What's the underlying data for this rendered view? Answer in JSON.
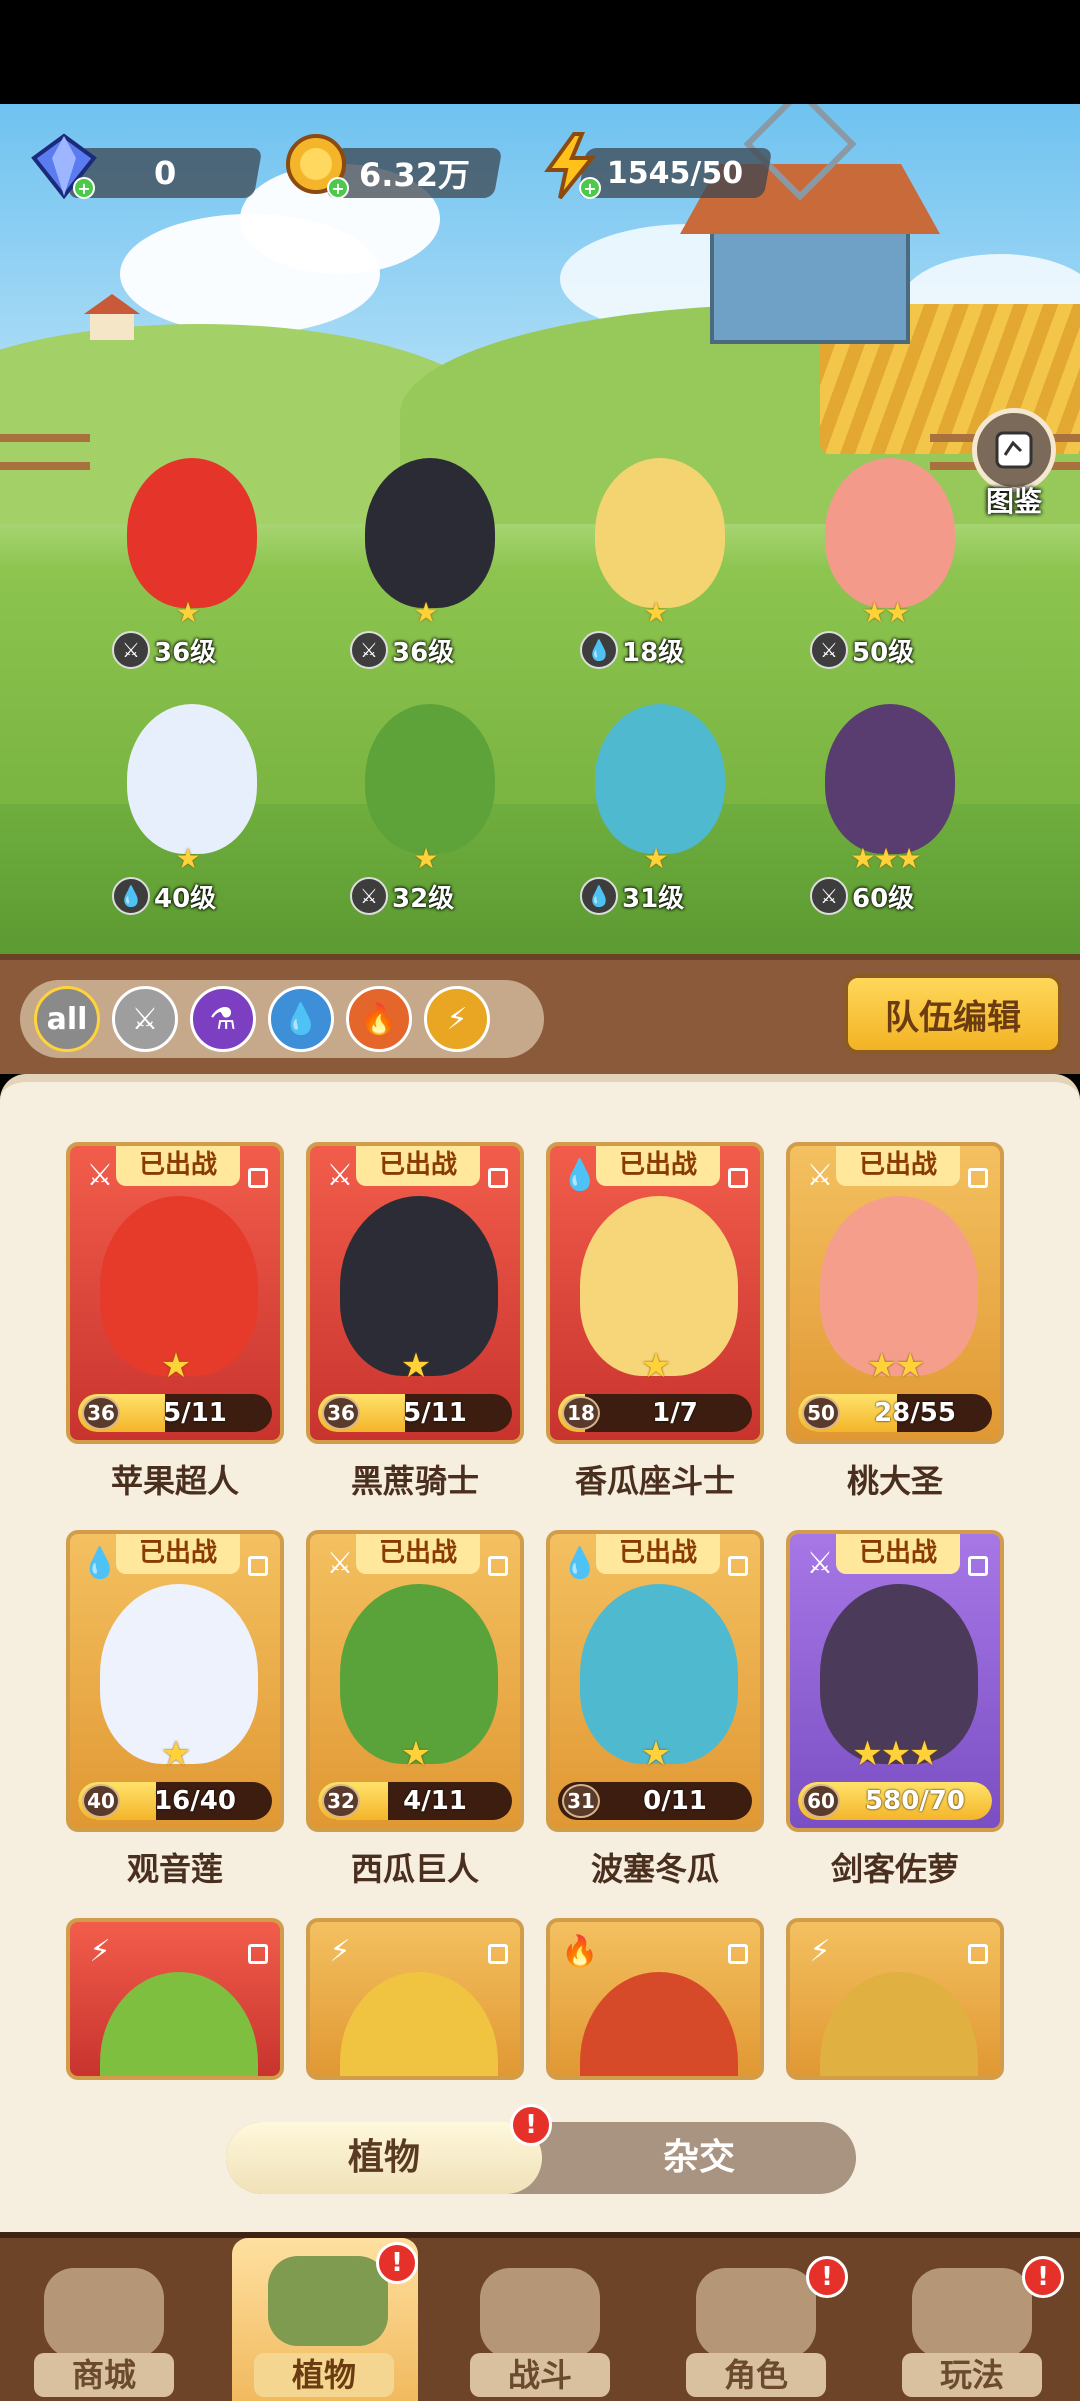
{
  "currencies": {
    "diamonds": "0",
    "coins": "6.32万",
    "energy": "1545/50"
  },
  "codex": {
    "label": "图鉴"
  },
  "field_units": [
    {
      "level": "36级",
      "element": "sword",
      "stars": "★",
      "color": "#e5352a"
    },
    {
      "level": "36级",
      "element": "sword",
      "stars": "★",
      "color": "#2b2b35"
    },
    {
      "level": "18级",
      "element": "water",
      "stars": "★",
      "color": "#f4d470"
    },
    {
      "level": "50级",
      "element": "sword",
      "stars": "★★",
      "color": "#f39a8a"
    },
    {
      "level": "40级",
      "element": "water",
      "stars": "★",
      "color": "#e7eefc"
    },
    {
      "level": "32级",
      "element": "sword",
      "stars": "★",
      "color": "#5ea33a"
    },
    {
      "level": "31级",
      "element": "water",
      "stars": "★",
      "color": "#4fb9cf"
    },
    {
      "level": "60级",
      "element": "sword",
      "stars": "★★★",
      "color": "#5a3d70"
    }
  ],
  "filters": [
    {
      "label": "all",
      "color": "#8a8a8a"
    },
    {
      "label": "⚔",
      "color": "#9e9e9e"
    },
    {
      "label": "⚗",
      "color": "#7c3fc2"
    },
    {
      "label": "💧",
      "color": "#3d8fd8"
    },
    {
      "label": "🔥",
      "color": "#e5662a"
    },
    {
      "label": "⚡",
      "color": "#e8a623"
    }
  ],
  "team_edit_label": "队伍编辑",
  "deployed_tag": "已出战",
  "cards": [
    {
      "name": "苹果超人",
      "level": "36",
      "progress": "5/11",
      "fill": 0.45,
      "stars": "★",
      "theme": "red",
      "element": "⚔",
      "portrait": "#e63b2b"
    },
    {
      "name": "黑蔗骑士",
      "level": "36",
      "progress": "5/11",
      "fill": 0.45,
      "stars": "★",
      "theme": "red",
      "element": "⚔",
      "portrait": "#2c2c36"
    },
    {
      "name": "香瓜座斗士",
      "level": "18",
      "progress": "1/7",
      "fill": 0.14,
      "stars": "★",
      "theme": "red",
      "element": "💧",
      "portrait": "#f7d67a"
    },
    {
      "name": "桃大圣",
      "level": "50",
      "progress": "28/55",
      "fill": 0.51,
      "stars": "★★",
      "theme": "gold",
      "element": "⚔",
      "portrait": "#f59e8c"
    },
    {
      "name": "观音莲",
      "level": "40",
      "progress": "16/40",
      "fill": 0.4,
      "stars": "★",
      "theme": "gold",
      "element": "💧",
      "portrait": "#eef2fc"
    },
    {
      "name": "西瓜巨人",
      "level": "32",
      "progress": "4/11",
      "fill": 0.36,
      "stars": "★",
      "theme": "gold",
      "element": "⚔",
      "portrait": "#5aa33a"
    },
    {
      "name": "波塞冬瓜",
      "level": "31",
      "progress": "0/11",
      "fill": 0.0,
      "stars": "★",
      "theme": "gold",
      "element": "💧",
      "portrait": "#4fb9cf"
    },
    {
      "name": "剑客佐萝",
      "level": "60",
      "progress": "580/70",
      "fill": 1.0,
      "stars": "★★★",
      "theme": "purple",
      "element": "⚔",
      "portrait": "#4b3a5a"
    }
  ],
  "partial_cards": [
    {
      "theme": "red",
      "element": "⚡",
      "portrait": "#7fbf3f"
    },
    {
      "theme": "gold",
      "element": "⚡",
      "portrait": "#f0c440"
    },
    {
      "theme": "gold",
      "element": "🔥",
      "portrait": "#d64a2a"
    },
    {
      "theme": "gold",
      "element": "⚡",
      "portrait": "#e0b040"
    }
  ],
  "toggle": {
    "plants": "植物",
    "hybrid": "杂交"
  },
  "alert_mark": "!",
  "nav": [
    {
      "label": "商城"
    },
    {
      "label": "植物"
    },
    {
      "label": "战斗"
    },
    {
      "label": "角色"
    },
    {
      "label": "玩法"
    }
  ]
}
